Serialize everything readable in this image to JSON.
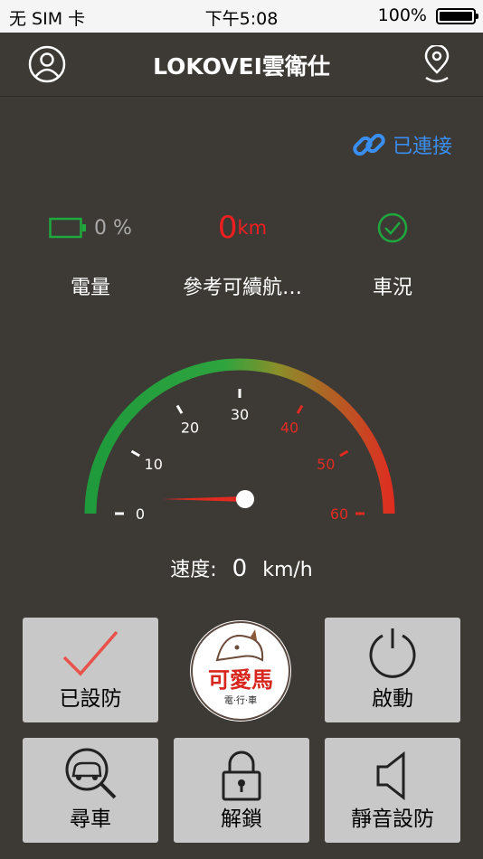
{
  "status_bar": {
    "carrier": "无 SIM 卡",
    "time": "下午5:08",
    "battery": "100%"
  },
  "header": {
    "title": "LOKOVEI雲衛仕"
  },
  "connection": {
    "label": "已連接",
    "color": "#3a8ef0"
  },
  "stats": {
    "battery": {
      "value": "0 %",
      "label": "電量",
      "level": 0
    },
    "range": {
      "value": "0",
      "unit": "km",
      "label": "參考可續航…"
    },
    "condition": {
      "label": "車況"
    }
  },
  "gauge": {
    "ticks": [
      "0",
      "10",
      "20",
      "30",
      "40",
      "50",
      "60"
    ],
    "min": 0,
    "max": 60,
    "value": 0,
    "colors": {
      "low": "#1e9a3c",
      "high": "#e02b20",
      "tick_red": "#e02b20"
    }
  },
  "speed": {
    "label": "速度:",
    "value": "0",
    "unit": "km/h"
  },
  "buttons": {
    "armed": "已設防",
    "start": "啟動",
    "find_car": "尋車",
    "unlock": "解鎖",
    "silent_arm": "靜音設防"
  },
  "logo": {
    "text": "可愛馬",
    "sub": "電·行·車"
  }
}
